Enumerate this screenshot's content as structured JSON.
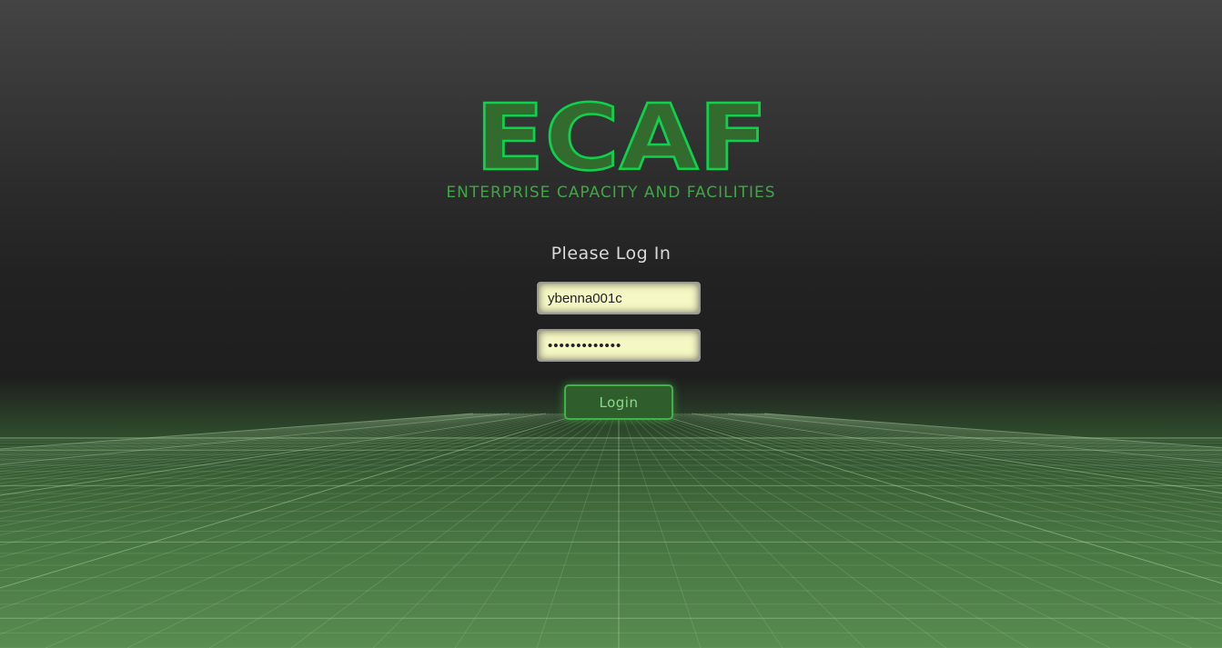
{
  "branding": {
    "logo_text": "ECAF",
    "subtitle": "ENTERPRISE CAPACITY AND FACILITIES"
  },
  "login": {
    "heading": "Please Log In",
    "username_value": "ybenna001c",
    "password_value": "•••••••••••••",
    "button_label": "Login"
  },
  "colors": {
    "logo_fill": "#336b2f",
    "logo_stroke": "#0fd24c",
    "subtitle": "#3fa746",
    "input_background": "#f5f7c4",
    "button_background": "#2f5e2c",
    "button_border": "#3fb24a"
  }
}
